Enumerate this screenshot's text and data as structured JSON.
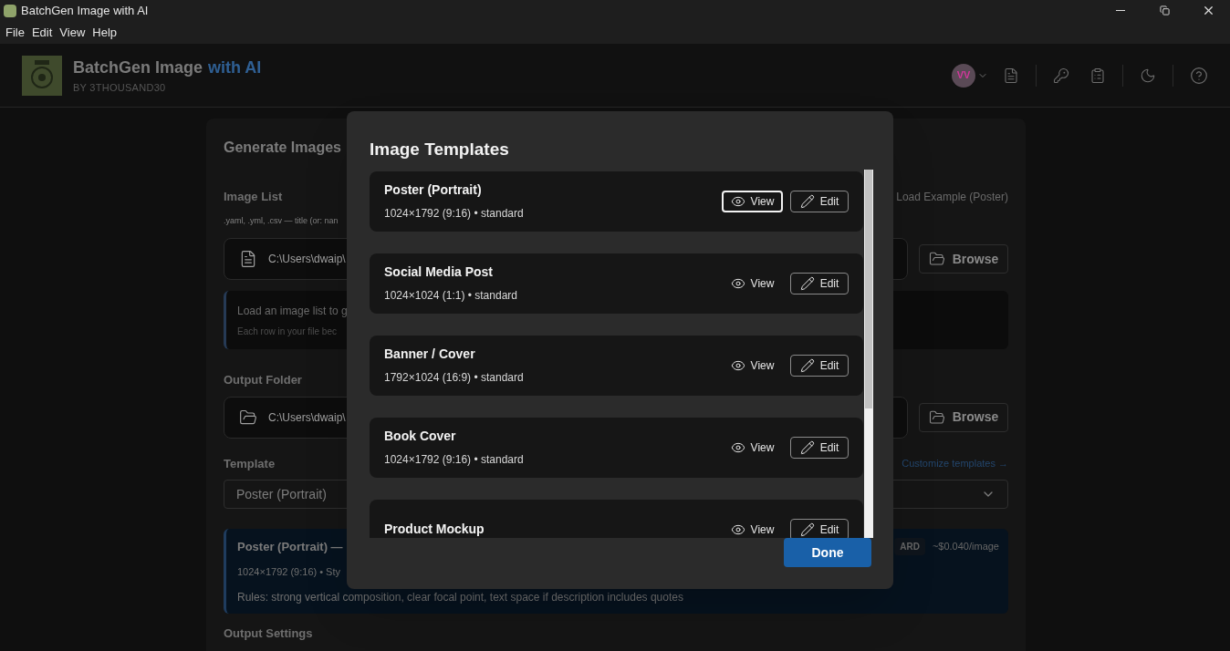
{
  "window": {
    "title": "BatchGen Image with AI"
  },
  "menu": [
    "File",
    "Edit",
    "View",
    "Help"
  ],
  "header": {
    "title": "BatchGen Image",
    "title_accent": "with AI",
    "subtitle": "BY 3THOUSAND30",
    "avatar": "VV"
  },
  "main": {
    "title": "Generate Images",
    "image_list": {
      "label": "Image List",
      "hint": ".yaml, .yml, .csv — title (or: nan",
      "path": "C:\\Users\\dwaip\\",
      "example_link": "Load Example (Poster)",
      "browse": "Browse"
    },
    "info": {
      "line_1": "Load an image list to g",
      "line_2": "Each row in your file bec"
    },
    "output_folder": {
      "label": "Output Folder",
      "path": "C:\\Users\\dwaip\\",
      "browse": "Browse"
    },
    "template": {
      "label": "Template",
      "link": "Customize templates →",
      "value": "Poster (Portrait)",
      "summary_title": "Poster (Portrait) —",
      "badge": "ARD",
      "price": "~$0.040/image",
      "summary_line": "1024×1792 (9:16) • Sty",
      "rules": "Rules: strong vertical composition, clear focal point, text space if description includes quotes"
    },
    "next_section": "Output Settings"
  },
  "dialog": {
    "title": "Image Templates",
    "done": "Done",
    "templates": [
      {
        "name": "Poster (Portrait)",
        "details": "1024×1792 (9:16) • standard",
        "view": "View",
        "edit": "Edit",
        "focused": true
      },
      {
        "name": "Social Media Post",
        "details": "1024×1024 (1:1) • standard",
        "view": "View",
        "edit": "Edit",
        "focused": false
      },
      {
        "name": "Banner / Cover",
        "details": "1792×1024 (16:9) • standard",
        "view": "View",
        "edit": "Edit",
        "focused": false
      },
      {
        "name": "Book Cover",
        "details": "1024×1792 (9:16) • standard",
        "view": "View",
        "edit": "Edit",
        "focused": false
      },
      {
        "name": "Product Mockup",
        "view": "View",
        "edit": "Edit",
        "focused": false
      }
    ]
  }
}
